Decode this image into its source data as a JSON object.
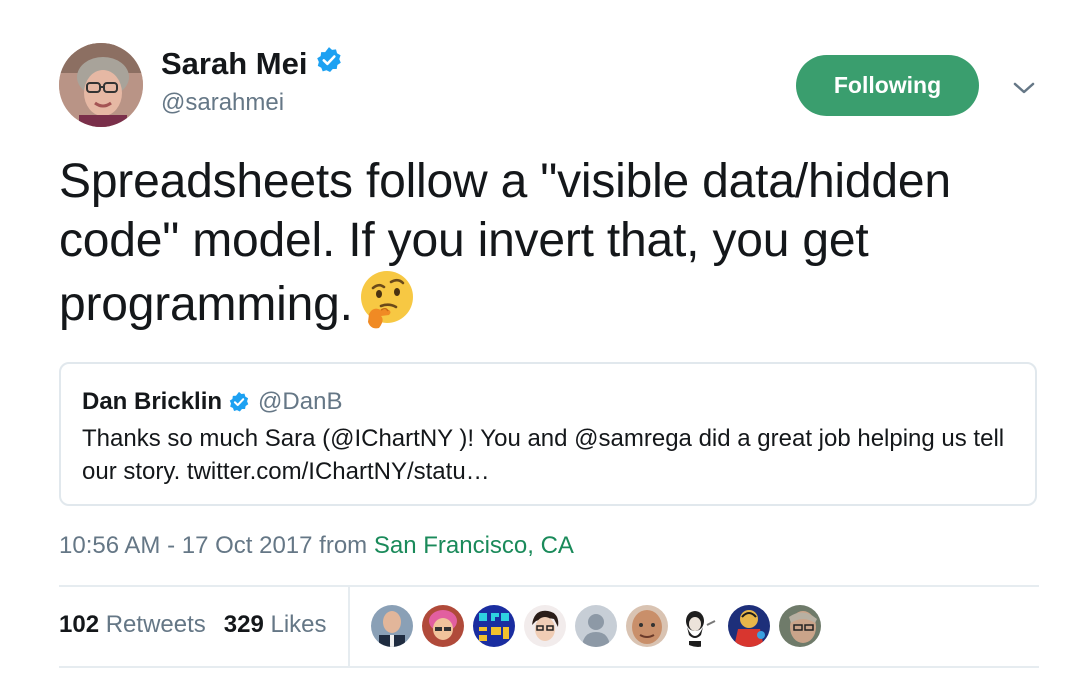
{
  "author": {
    "name": "Sarah Mei",
    "handle": "@sarahmei",
    "verified": true
  },
  "follow_button": {
    "label": "Following",
    "color": "#3a9e6e"
  },
  "tweet": {
    "text": "Spreadsheets follow a \"visible data/hidden code\" model. If you invert that, you get programming.",
    "emoji_icon": "thinking-face-icon"
  },
  "quote": {
    "name": "Dan Bricklin",
    "handle": "@DanB",
    "verified": true,
    "text": "Thanks so much Sara (@IChartNY )! You and @samrega did a great job helping us tell our story. twitter.com/IChartNY/statu…"
  },
  "meta": {
    "time": "10:56 AM - 17 Oct 2017",
    "from_label": "from",
    "location": "San Francisco, CA"
  },
  "stats": {
    "retweets_count": "102",
    "retweets_label": "Retweets",
    "likes_count": "329",
    "likes_label": "Likes"
  },
  "likers": [
    "liker-avatar",
    "liker-avatar",
    "liker-avatar",
    "liker-avatar",
    "liker-avatar",
    "liker-avatar",
    "liker-avatar",
    "liker-avatar",
    "liker-avatar"
  ],
  "colors": {
    "verified_blue": "#1da1f2",
    "location_green": "#1a8a5a",
    "secondary_gray": "#657786"
  }
}
